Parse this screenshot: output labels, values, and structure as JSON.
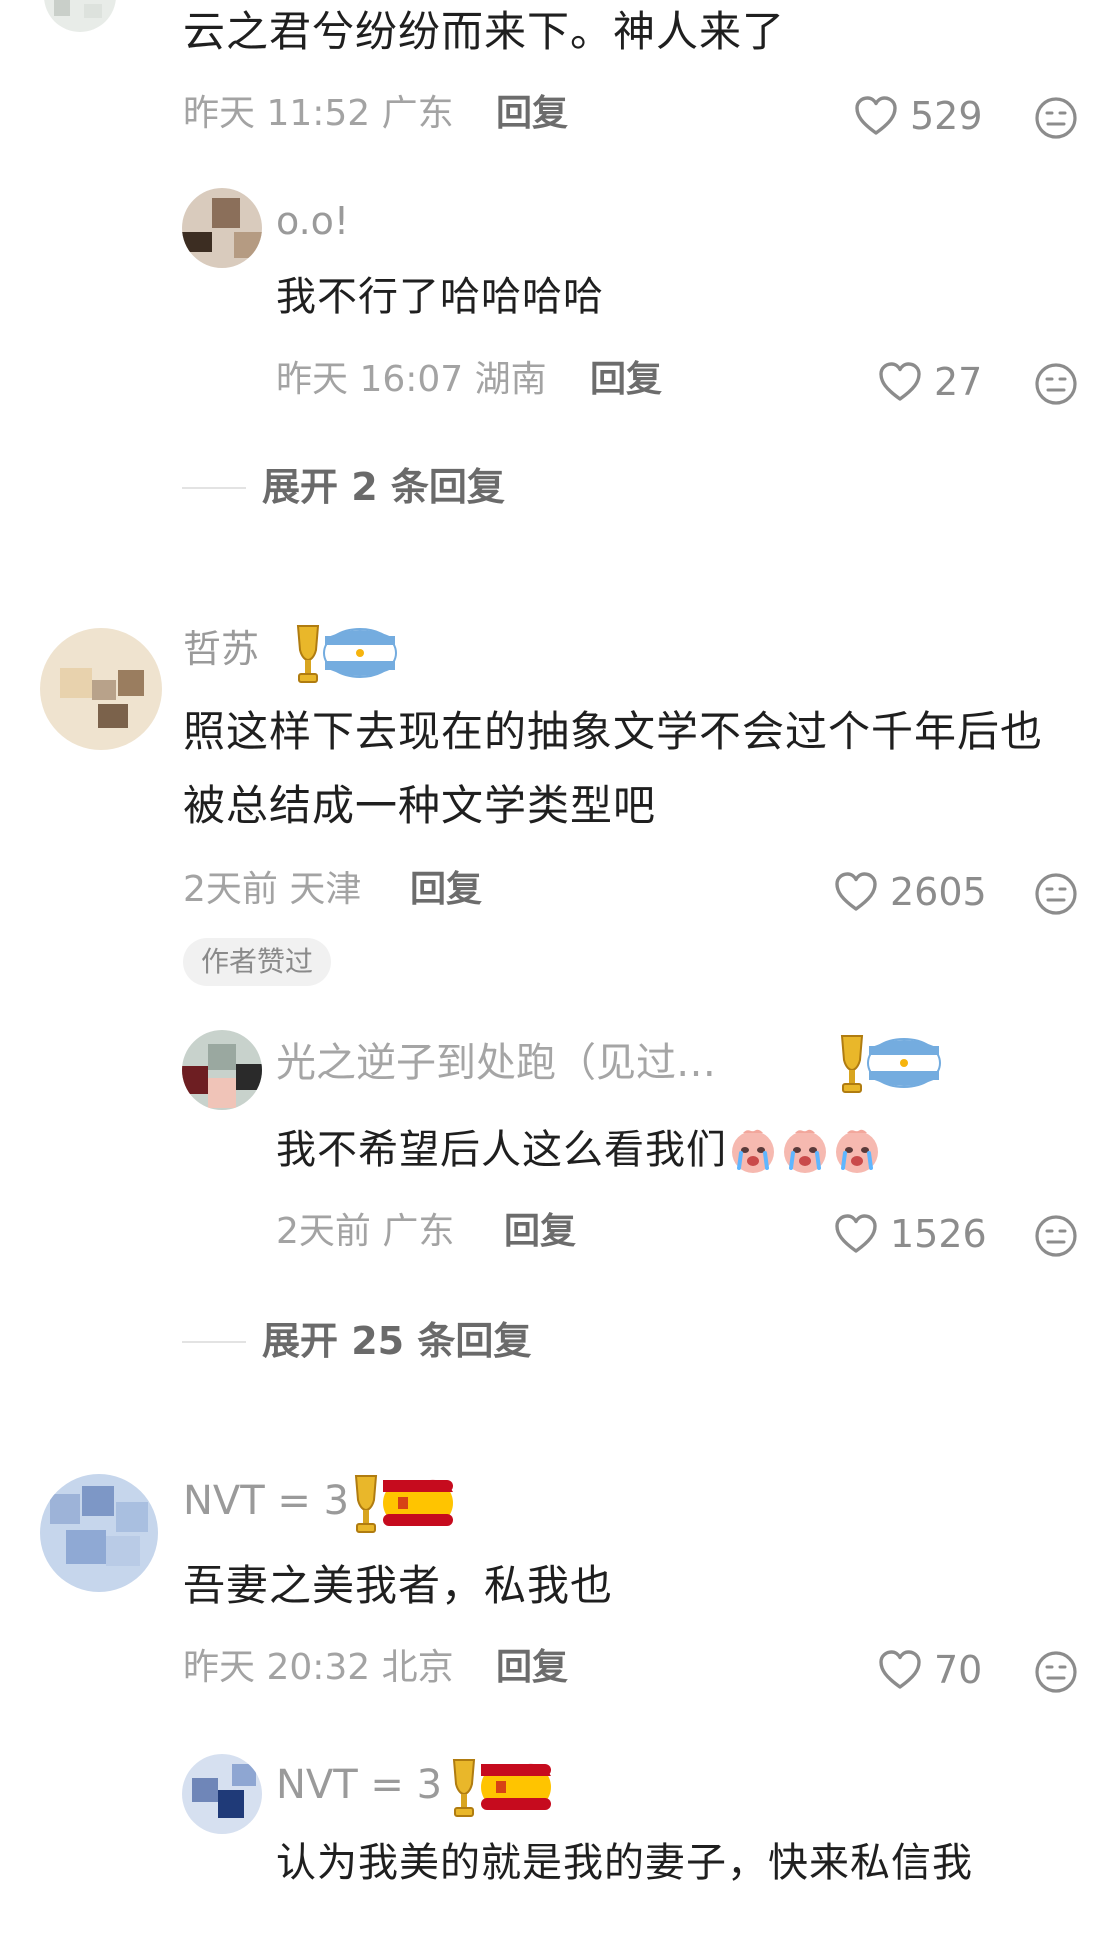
{
  "comments": [
    {
      "text": "云之君兮纷纷而来下。神人来了",
      "time": "昨天 11:52",
      "location": "广东",
      "reply_label": "回复",
      "likes": "529",
      "replies": [
        {
          "username": "o.o!",
          "text": "我不行了哈哈哈哈",
          "time": "昨天 16:07",
          "location": "湖南",
          "reply_label": "回复",
          "likes": "27"
        }
      ],
      "expand_label": "展开 2 条回复"
    },
    {
      "username": "哲苏",
      "text_line1": "照这样下去现在的抽象文学不会过个千年后也",
      "text_line2": "被总结成一种文学类型吧",
      "time": "2天前",
      "location": "天津",
      "reply_label": "回复",
      "likes": "2605",
      "author_liked": "作者赞过",
      "replies": [
        {
          "username": "光之逆子到处跑（见过…",
          "text": "我不希望后人这么看我们",
          "time": "2天前",
          "location": "广东",
          "reply_label": "回复",
          "likes": "1526"
        }
      ],
      "expand_label": "展开 25 条回复"
    },
    {
      "username": "NVT = 3",
      "text": "吾妻之美我者，私我也",
      "time": "昨天 20:32",
      "location": "北京",
      "reply_label": "回复",
      "likes": "70",
      "replies": [
        {
          "username": "NVT = 3",
          "text": "认为我美的就是我的妻子，快来私信我"
        }
      ]
    }
  ],
  "icons": {
    "like": "heart-outline-icon",
    "dislike": "meh-face-icon",
    "badge_argentina": "trophy-argentina-flag-icon",
    "badge_spain": "trophy-spain-flag-icon",
    "emoji": "crying-face-emoji"
  },
  "colors": {
    "meta": "#a3a3a3",
    "username": "#9a9a9a",
    "reply": "#6c6c6c"
  }
}
